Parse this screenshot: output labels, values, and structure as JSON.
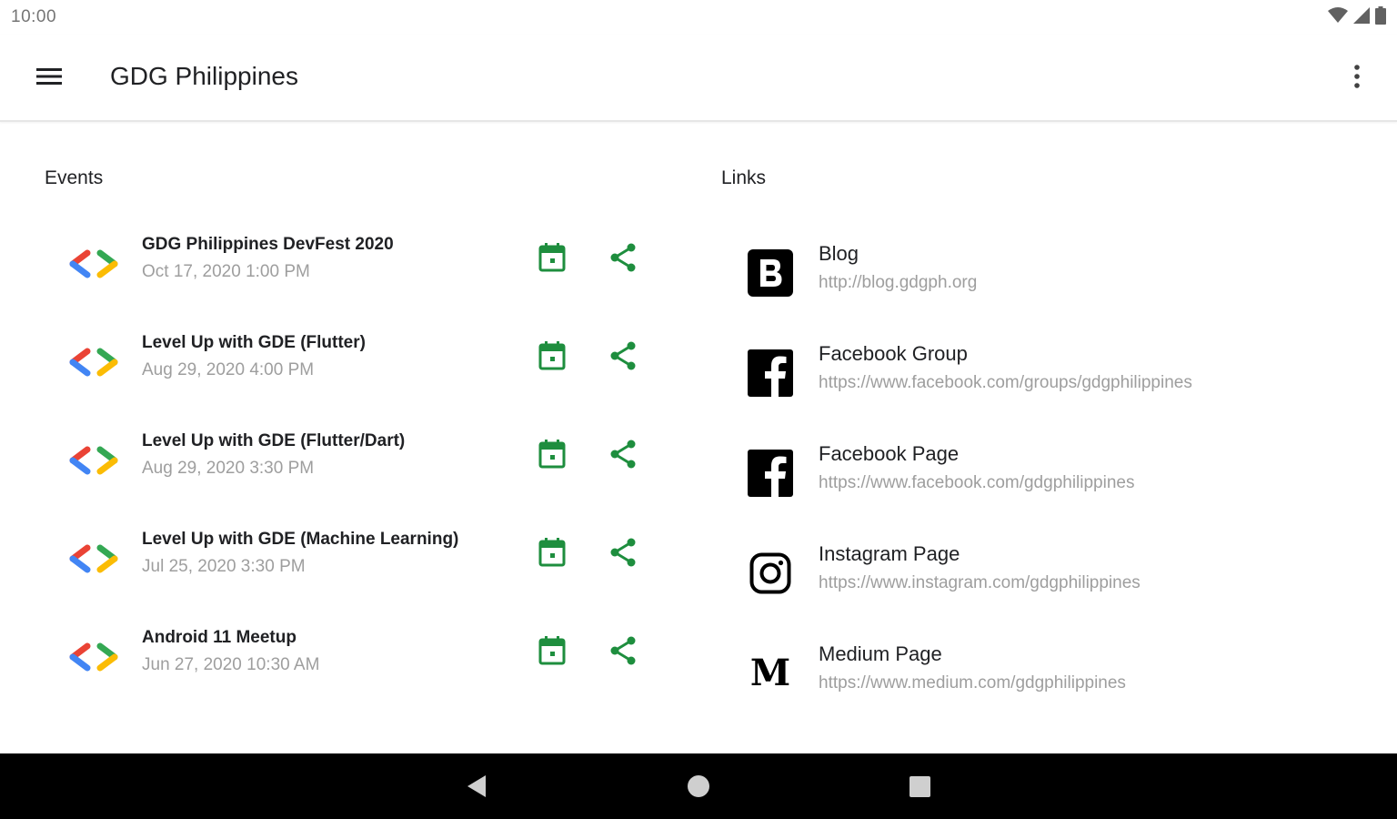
{
  "status_bar": {
    "time": "10:00"
  },
  "app_bar": {
    "title": "GDG Philippines"
  },
  "events": {
    "title": "Events",
    "items": [
      {
        "name": "GDG Philippines DevFest 2020",
        "date": "Oct 17, 2020 1:00 PM"
      },
      {
        "name": "Level Up with GDE (Flutter)",
        "date": "Aug 29, 2020 4:00 PM"
      },
      {
        "name": "Level Up with GDE (Flutter/Dart)",
        "date": "Aug 29, 2020 3:30 PM"
      },
      {
        "name": "Level Up with GDE (Machine Learning)",
        "date": "Jul 25, 2020 3:30 PM"
      },
      {
        "name": "Android 11 Meetup",
        "date": "Jun 27, 2020 10:30 AM"
      }
    ]
  },
  "links": {
    "title": "Links",
    "items": [
      {
        "name": "Blog",
        "url": "http://blog.gdgph.org",
        "icon": "blogger-icon"
      },
      {
        "name": "Facebook Group",
        "url": "https://www.facebook.com/groups/gdgphilippines",
        "icon": "facebook-icon"
      },
      {
        "name": "Facebook Page",
        "url": "https://www.facebook.com/gdgphilippines",
        "icon": "facebook-icon"
      },
      {
        "name": "Instagram Page",
        "url": "https://www.instagram.com/gdgphilippines",
        "icon": "instagram-icon"
      },
      {
        "name": "Medium Page",
        "url": "https://www.medium.com/gdgphilippines",
        "icon": "medium-icon",
        "glyph": "M"
      }
    ]
  },
  "colors": {
    "accent_green": "#1e8e3e",
    "gdg_red": "#ea4335",
    "gdg_blue": "#4285f4",
    "gdg_green": "#34a853",
    "gdg_yellow": "#fbbc04"
  }
}
